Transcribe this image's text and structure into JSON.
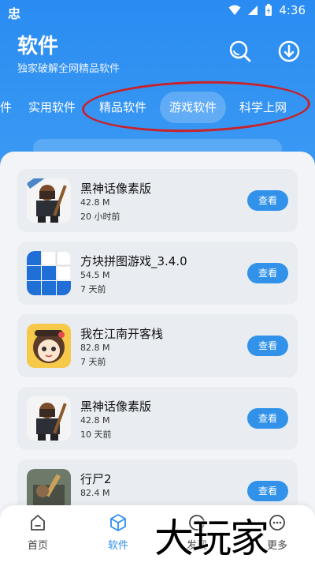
{
  "status_bar": {
    "app_icon": "忠",
    "time": "4:36"
  },
  "header": {
    "title": "软件",
    "subtitle": "独家破解全网精品软件",
    "search_icon": "search-icon",
    "download_icon": "download-icon"
  },
  "tabs": [
    {
      "label": "件"
    },
    {
      "label": "实用软件"
    },
    {
      "label": "精品软件"
    },
    {
      "label": "游戏软件",
      "active": true
    },
    {
      "label": "科学上网"
    }
  ],
  "apps": [
    {
      "name": "黑神话像素版",
      "size": "42.8 M",
      "time": "20 小时前",
      "button": "查看"
    },
    {
      "name": "方块拼图游戏_3.4.0",
      "size": "54.5 M",
      "time": "7 天前",
      "button": "查看"
    },
    {
      "name": "我在江南开客栈",
      "size": "82.8 M",
      "time": "7 天前",
      "button": "查看"
    },
    {
      "name": "黑神话像素版",
      "size": "42.8 M",
      "time": "10 天前",
      "button": "查看"
    },
    {
      "name": "行尸2",
      "size": "82.4 M",
      "time": "",
      "button": "查看"
    }
  ],
  "bottom_nav": [
    {
      "label": "首页",
      "icon": "home-icon"
    },
    {
      "label": "软件",
      "icon": "cube-icon",
      "active": true
    },
    {
      "label": "发现",
      "icon": "compass-icon"
    },
    {
      "label": "更多",
      "icon": "more-icon"
    }
  ],
  "watermark": "大玩家",
  "colors": {
    "primary": "#2f8ff0",
    "button": "#3292ea",
    "card_bg": "#e9edf2",
    "highlight": "#c8222a"
  }
}
